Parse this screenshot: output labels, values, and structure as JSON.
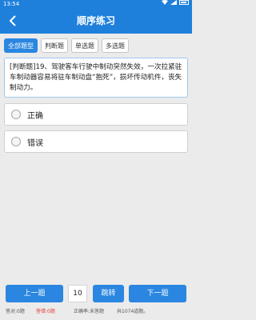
{
  "statusbar": {
    "time": "13:54"
  },
  "header": {
    "title": "顺序练习"
  },
  "tabs": [
    {
      "label": "全部题型",
      "active": true
    },
    {
      "label": "判断题",
      "active": false
    },
    {
      "label": "单选题",
      "active": false
    },
    {
      "label": "多选题",
      "active": false
    }
  ],
  "question": {
    "text": "[判断题]19、驾驶客车行驶中制动突然失效，一次拉紧驻车制动器容易将驻车制动盘“抱死”，损坏传动机件，丧失制动力。"
  },
  "options": [
    {
      "label": "正确"
    },
    {
      "label": "错误"
    }
  ],
  "navigation": {
    "prev_label": "上一题",
    "page_value": "10",
    "jump_label": "跳转",
    "next_label": "下一题"
  },
  "stats": {
    "correct": "答对:0题",
    "wrong": "答错:0题",
    "accuracy": "正确率:未答题",
    "total": "共1074道题。"
  },
  "colors": {
    "primary": "#1f80dc",
    "button": "#2a86e0",
    "wrong": "#e03a3a"
  }
}
